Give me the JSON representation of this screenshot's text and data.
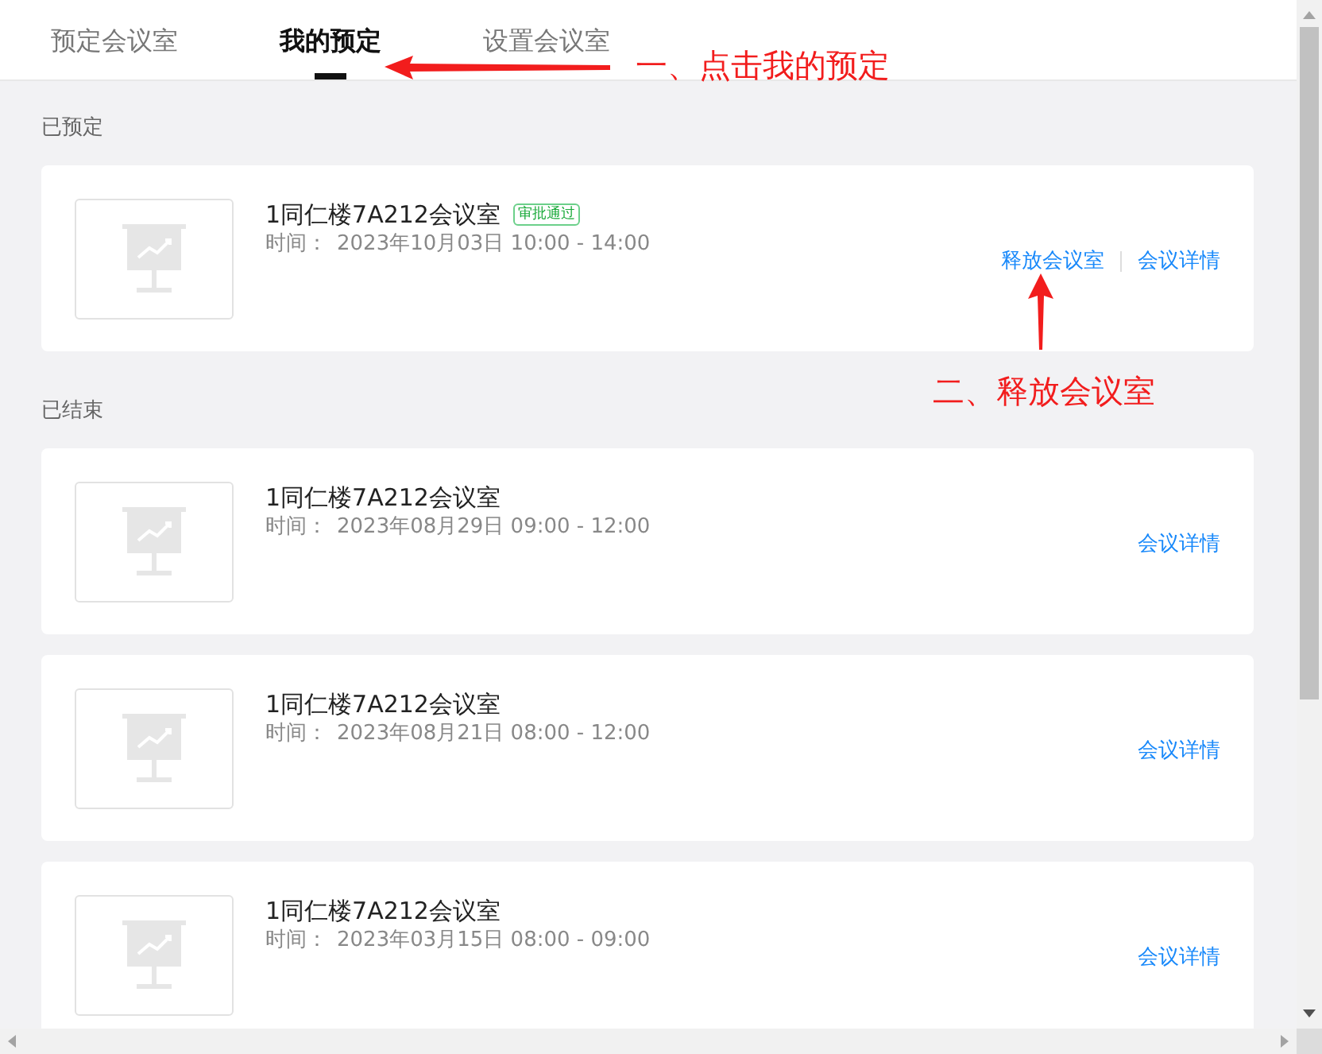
{
  "tabs": [
    {
      "label": "预定会议室",
      "selected": false
    },
    {
      "label": "我的预定",
      "selected": true
    },
    {
      "label": "设置会议室",
      "selected": false
    }
  ],
  "sections": [
    {
      "title": "已预定",
      "bookings": [
        {
          "room": "1同仁楼7A212会议室",
          "status": "审批通过",
          "time_label": "时间：",
          "time": "2023年10月03日 10:00 - 14:00",
          "actions": [
            "释放会议室",
            "会议详情"
          ]
        }
      ]
    },
    {
      "title": "已结束",
      "bookings": [
        {
          "room": "1同仁楼7A212会议室",
          "time_label": "时间：",
          "time": "2023年08月29日 09:00 - 12:00",
          "actions": [
            "会议详情"
          ]
        },
        {
          "room": "1同仁楼7A212会议室",
          "time_label": "时间：",
          "time": "2023年08月21日 08:00 - 12:00",
          "actions": [
            "会议详情"
          ]
        },
        {
          "room": "1同仁楼7A212会议室",
          "time_label": "时间：",
          "time": "2023年03月15日 08:00 - 09:00",
          "actions": [
            "会议详情"
          ]
        }
      ]
    }
  ],
  "annotations": [
    {
      "text": "一、点击我的预定",
      "kind": "left"
    },
    {
      "text": "二、释放会议室",
      "kind": "up"
    }
  ]
}
